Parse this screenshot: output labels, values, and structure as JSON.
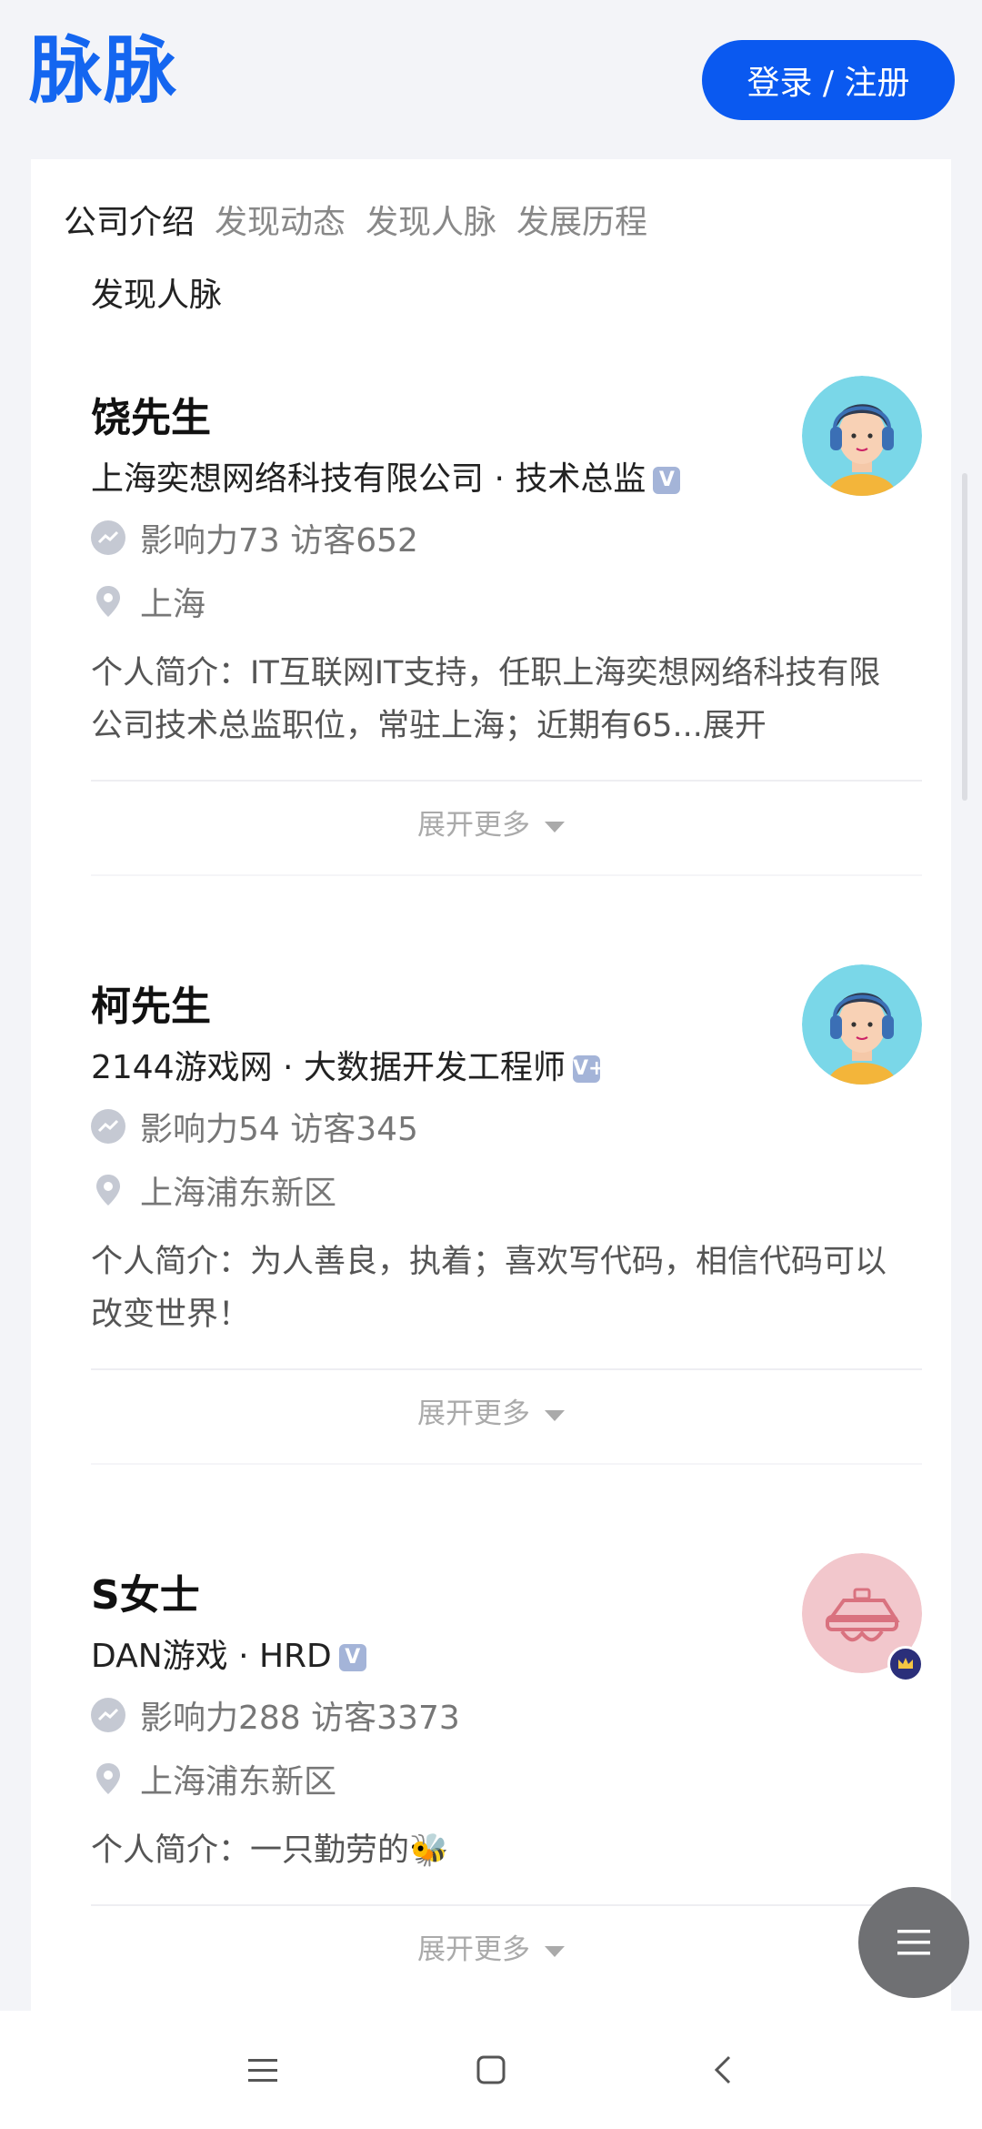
{
  "header": {
    "logo": "脉脉",
    "login_label": "登录 / 注册"
  },
  "tabs": [
    "公司介绍",
    "发现动态",
    "发现人脉",
    "发展历程"
  ],
  "active_tab": 0,
  "section_title": "发现人脉",
  "people": [
    {
      "name": "饶先生",
      "company": "上海奕想网络科技有限公司 · 技术总监",
      "badge": "V",
      "stats": "影响力73 访客652",
      "location": "上海",
      "bio": "个人简介：IT互联网IT支持，任职上海奕想网络科技有限公司技术总监职位，常驻上海；近期有65...展开",
      "more_label": "展开更多"
    },
    {
      "name": "柯先生",
      "company": "2144游戏网 · 大数据开发工程师",
      "badge": "V+",
      "stats": "影响力54 访客345",
      "location": "上海浦东新区",
      "bio": "个人简介：为人善良，执着；喜欢写代码，相信代码可以改变世界！",
      "more_label": "展开更多"
    },
    {
      "name": "S女士",
      "company": "DAN游戏 · HRD",
      "badge": "V",
      "stats": "影响力288 访客3373",
      "location": "上海浦东新区",
      "bio": "个人简介：一只勤劳的🐝",
      "more_label": "展开更多"
    }
  ],
  "colors": {
    "brand": "#1466f0",
    "button": "#0a59f0"
  }
}
